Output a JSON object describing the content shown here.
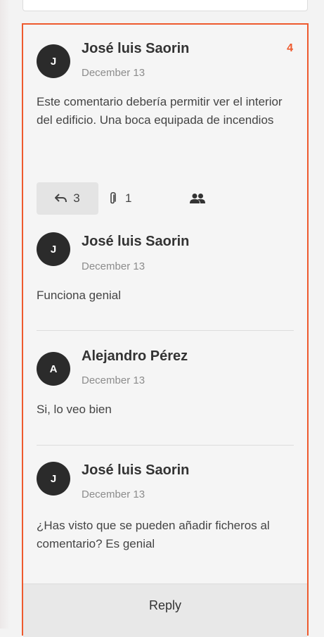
{
  "comment": {
    "avatar_initial": "J",
    "author": "José luis Saorin",
    "date": "December 13",
    "count": "4",
    "body": "Este comentario debería permitir ver el interior del edificio. Una boca equipada de incendios",
    "actions": {
      "replies_count": "3",
      "attachments_count": "1",
      "reply_icon": "reply-arrow-icon",
      "attachment_icon": "paperclip-icon",
      "users_icon": "users-icon"
    }
  },
  "replies": [
    {
      "avatar_initial": "J",
      "author": "José luis Saorin",
      "date": "December 13",
      "body": "Funciona genial"
    },
    {
      "avatar_initial": "A",
      "author": "Alejandro Pérez",
      "date": "December 13",
      "body": "Si, lo veo bien"
    },
    {
      "avatar_initial": "J",
      "author": "José luis Saorin",
      "date": "December 13",
      "body": "¿Has visto que se pueden añadir ficheros al comentario? Es genial"
    }
  ],
  "reply_button": {
    "label": "Reply"
  },
  "colors": {
    "accent": "#ee5a2e",
    "avatar_bg": "#2b2b2b"
  }
}
